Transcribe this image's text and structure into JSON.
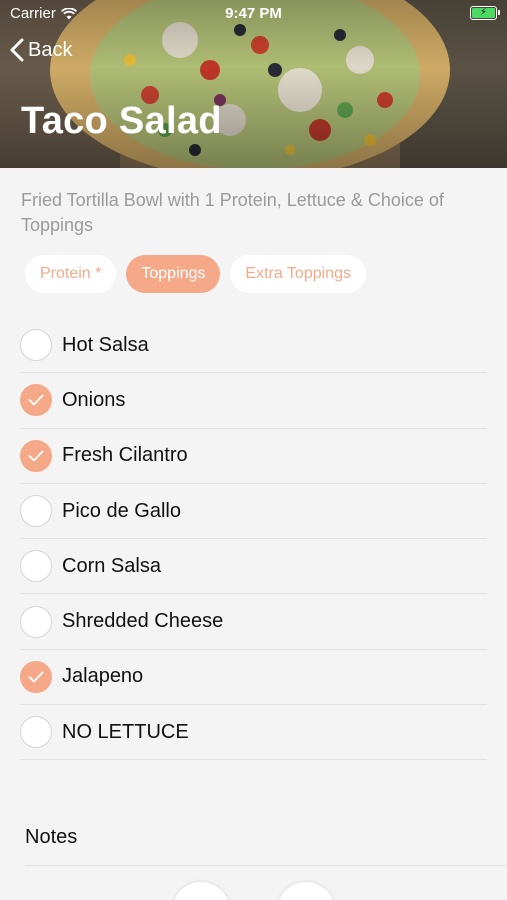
{
  "status": {
    "carrier": "Carrier",
    "time": "9:47 PM"
  },
  "nav": {
    "back_label": "Back"
  },
  "item": {
    "title": "Taco Salad",
    "description": "Fried Tortilla Bowl with 1 Protein, Lettuce & Choice of Toppings"
  },
  "tabs": [
    {
      "label": "Protein *",
      "active": false
    },
    {
      "label": "Toppings",
      "active": true
    },
    {
      "label": "Extra Toppings",
      "active": false
    }
  ],
  "options": [
    {
      "label": "Hot Salsa",
      "checked": false
    },
    {
      "label": "Onions",
      "checked": true
    },
    {
      "label": "Fresh Cilantro",
      "checked": true
    },
    {
      "label": "Pico de Gallo",
      "checked": false
    },
    {
      "label": "Corn Salsa",
      "checked": false
    },
    {
      "label": "Shredded Cheese",
      "checked": false
    },
    {
      "label": "Jalapeno",
      "checked": true
    },
    {
      "label": "NO LETTUCE",
      "checked": false
    }
  ],
  "notes": {
    "label": "Notes"
  },
  "colors": {
    "accent": "#f5a988",
    "accent_text": "#f4a98a",
    "battery": "#4cd964"
  }
}
